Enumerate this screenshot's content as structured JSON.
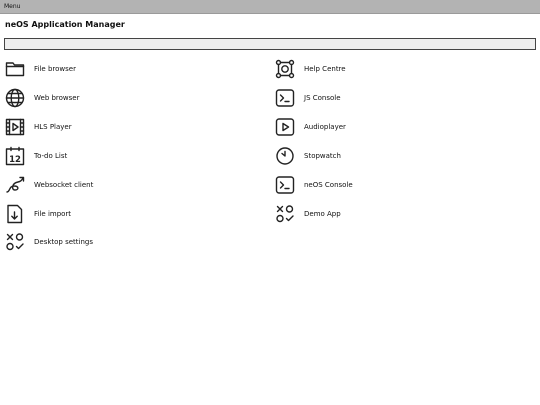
{
  "menubar": {
    "label": "Menu"
  },
  "header": {
    "title": "neOS Application Manager"
  },
  "search": {
    "value": "",
    "placeholder": ""
  },
  "apps": {
    "left": [
      {
        "label": "File browser",
        "icon": "folder-icon"
      },
      {
        "label": "Web browser",
        "icon": "globe-icon"
      },
      {
        "label": "HLS Player",
        "icon": "film-play-icon"
      },
      {
        "label": "To-do List",
        "icon": "calendar-icon"
      },
      {
        "label": "Websocket client",
        "icon": "cable-icon"
      },
      {
        "label": "File import",
        "icon": "file-import-icon"
      },
      {
        "label": "Desktop settings",
        "icon": "settings-shapes-icon"
      }
    ],
    "right": [
      {
        "label": "Help Centre",
        "icon": "nodes-icon"
      },
      {
        "label": "JS Console",
        "icon": "terminal-icon"
      },
      {
        "label": "Audioplayer",
        "icon": "play-box-icon"
      },
      {
        "label": "Stopwatch",
        "icon": "clock-icon"
      },
      {
        "label": "neOS Console",
        "icon": "terminal-icon"
      },
      {
        "label": "Demo App",
        "icon": "shapes-icon"
      }
    ]
  },
  "calendar_day": "12",
  "colors": {
    "menubar": "#b3b3b3",
    "search_bg": "#eeeeee",
    "text": "#111111"
  }
}
